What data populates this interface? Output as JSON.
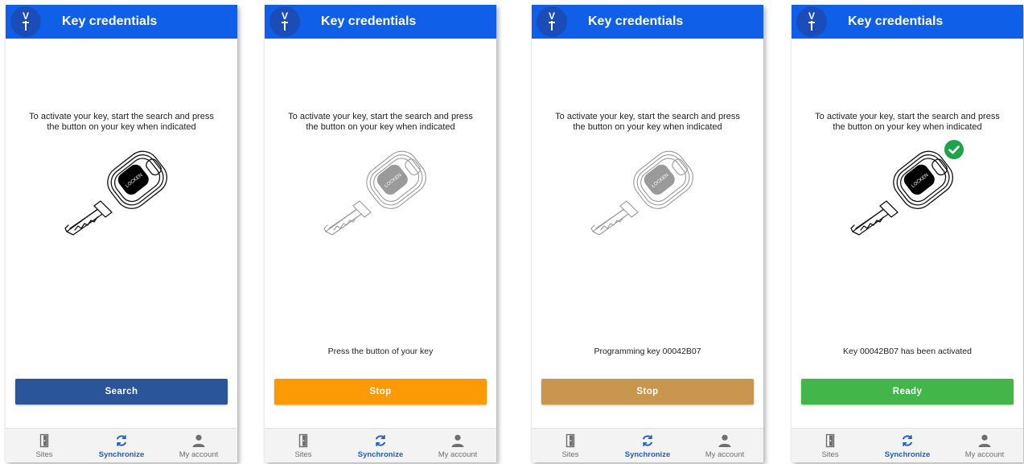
{
  "app": {
    "title": "Key credentials",
    "logo_letters": "VT"
  },
  "instruction_line1": "To activate your key, start the search and press",
  "instruction_line2": "the button on your key when indicated",
  "key_brand": "LOCKEN",
  "nav": {
    "sites": "Sites",
    "synchronize": "Synchronize",
    "my_account": "My account",
    "active_color": "#1d5ec4",
    "icons": [
      "door-icon",
      "sync-icon",
      "person-icon"
    ]
  },
  "screens": [
    {
      "state": "idle",
      "status": "",
      "button_label": "Search",
      "button_color": "#2a5599",
      "key_faded": false,
      "checkmark": false
    },
    {
      "state": "searching",
      "status": "Press the button of your key",
      "button_label": "Stop",
      "button_color": "#fb9a05",
      "key_faded": true,
      "checkmark": false
    },
    {
      "state": "programming",
      "status": "Programming key 00042B07",
      "button_label": "Stop",
      "button_color": "#c8964f",
      "key_faded": true,
      "checkmark": false
    },
    {
      "state": "activated",
      "status": "Key 00042B07 has been activated",
      "button_label": "Ready",
      "button_color": "#43b649",
      "key_faded": false,
      "checkmark": true,
      "checkmark_color": "#1fa34a"
    }
  ]
}
